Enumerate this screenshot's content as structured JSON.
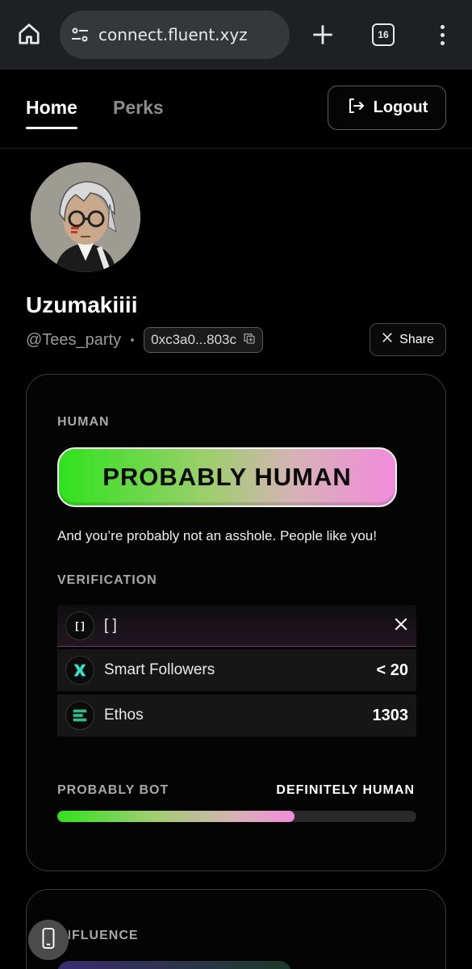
{
  "browser": {
    "url": "connect.fluent.xyz",
    "tab_count": "16"
  },
  "nav": {
    "tabs": [
      {
        "label": "Home",
        "active": true
      },
      {
        "label": "Perks",
        "active": false
      }
    ],
    "logout_label": "Logout"
  },
  "profile": {
    "username": "Uzumakiiii",
    "handle": "@Tees_party",
    "address": "0xc3a0...803c",
    "share_label": "Share"
  },
  "human_card": {
    "section_label": "HUMAN",
    "badge_text": "PROBABLY HUMAN",
    "tagline": "And you’re probably not an asshole. People like you!",
    "verification_label": "VERIFICATION",
    "verifications": [
      {
        "icon": "bracket-icon",
        "icon_text": "[ ]",
        "name": "[ ]",
        "value": ""
      },
      {
        "icon": "smart-followers-icon",
        "name": "Smart Followers",
        "value": "< 20"
      },
      {
        "icon": "ethos-icon",
        "name": "Ethos",
        "value": "1303"
      }
    ],
    "meter": {
      "left_label": "PROBABLY BOT",
      "right_label": "DEFINITELY HUMAN",
      "level": 0.66
    }
  },
  "influence_card": {
    "section_label": "INFLUENCE"
  },
  "colors": {
    "accent_green": "#2ee31c",
    "accent_pink": "#f38bdc",
    "background": "#000000",
    "chrome": "#1f2023"
  }
}
